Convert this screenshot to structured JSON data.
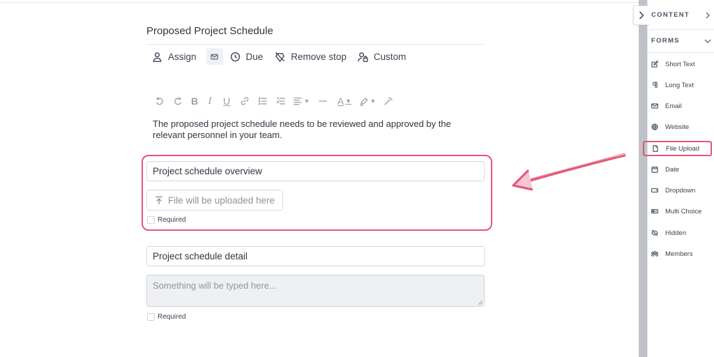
{
  "form": {
    "title": "Proposed Project Schedule",
    "actions": {
      "assign": "Assign",
      "due": "Due",
      "remove_stop": "Remove stop",
      "custom": "Custom"
    },
    "description": "The proposed project schedule needs to be reviewed and approved by the relevant personnel in your team.",
    "fields": [
      {
        "label": "Project schedule overview",
        "upload_placeholder": "File will be uploaded here",
        "required_label": "Required"
      },
      {
        "label": "Project schedule detail",
        "textarea_placeholder": "Something will be typed here...",
        "required_label": "Required"
      }
    ]
  },
  "sidebar": {
    "content_label": "CONTENT",
    "forms_label": "FORMS",
    "items": [
      {
        "label": "Short Text",
        "icon": "edit-icon"
      },
      {
        "label": "Long Text",
        "icon": "paragraph-icon"
      },
      {
        "label": "Email",
        "icon": "mail-icon"
      },
      {
        "label": "Website",
        "icon": "globe-icon"
      },
      {
        "label": "File Upload",
        "icon": "file-icon"
      },
      {
        "label": "Date",
        "icon": "calendar-icon"
      },
      {
        "label": "Dropdown",
        "icon": "dropdown-icon"
      },
      {
        "label": "Multi Choice",
        "icon": "multi-choice-icon"
      },
      {
        "label": "Hidden",
        "icon": "eye-off-icon"
      },
      {
        "label": "Members",
        "icon": "users-icon"
      }
    ]
  },
  "colors": {
    "highlight": "#e35576",
    "text": "#2f3541",
    "muted": "#8b929c"
  }
}
